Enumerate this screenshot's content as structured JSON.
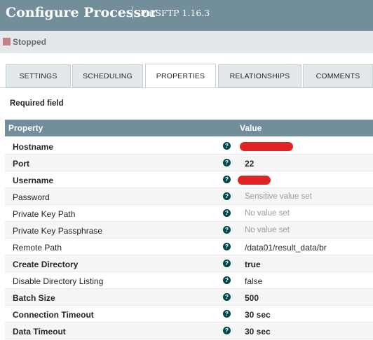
{
  "header": {
    "title": "Configure Processor",
    "subtitle": "PutSFTP 1.16.3"
  },
  "status": {
    "label": "Stopped",
    "color": "#c78184"
  },
  "tabs": [
    {
      "label": "SETTINGS",
      "active": false
    },
    {
      "label": "SCHEDULING",
      "active": false
    },
    {
      "label": "PROPERTIES",
      "active": true
    },
    {
      "label": "RELATIONSHIPS",
      "active": false
    },
    {
      "label": "COMMENTS",
      "active": false
    }
  ],
  "required_field_label": "Required field",
  "table": {
    "headers": {
      "property": "Property",
      "value": "Value"
    },
    "rows": [
      {
        "name": "Hostname",
        "value": "",
        "redacted": true,
        "required": true
      },
      {
        "name": "Port",
        "value": "22",
        "required": true
      },
      {
        "name": "Username",
        "value": "",
        "redacted": true,
        "required": true
      },
      {
        "name": "Password",
        "value": "Sensitive value set",
        "required": false,
        "muted": true
      },
      {
        "name": "Private Key Path",
        "value": "No value set",
        "required": false,
        "muted": true
      },
      {
        "name": "Private Key Passphrase",
        "value": "No value set",
        "required": false,
        "muted": true
      },
      {
        "name": "Remote Path",
        "value": "/data01/result_data/br",
        "required": false
      },
      {
        "name": "Create Directory",
        "value": "true",
        "required": true
      },
      {
        "name": "Disable Directory Listing",
        "value": "false",
        "required": false
      },
      {
        "name": "Batch Size",
        "value": "500",
        "required": true
      },
      {
        "name": "Connection Timeout",
        "value": "30 sec",
        "required": true
      },
      {
        "name": "Data Timeout",
        "value": "30 sec",
        "required": true
      }
    ]
  },
  "icons": {
    "help": "question-circle-icon",
    "status": "stopped-square-icon"
  },
  "colors": {
    "header": "#728e9b",
    "accent": "#004849",
    "redaction": "#e02424"
  }
}
